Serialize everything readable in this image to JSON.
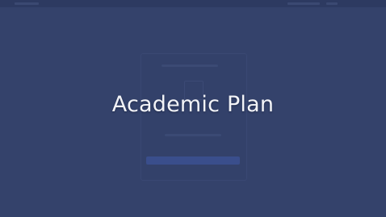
{
  "overlay": {
    "title": "Academic Plan"
  },
  "colors": {
    "background": "#34426b",
    "title_text": "#f2f3f7",
    "ghost_button": "#3a4e8c"
  }
}
